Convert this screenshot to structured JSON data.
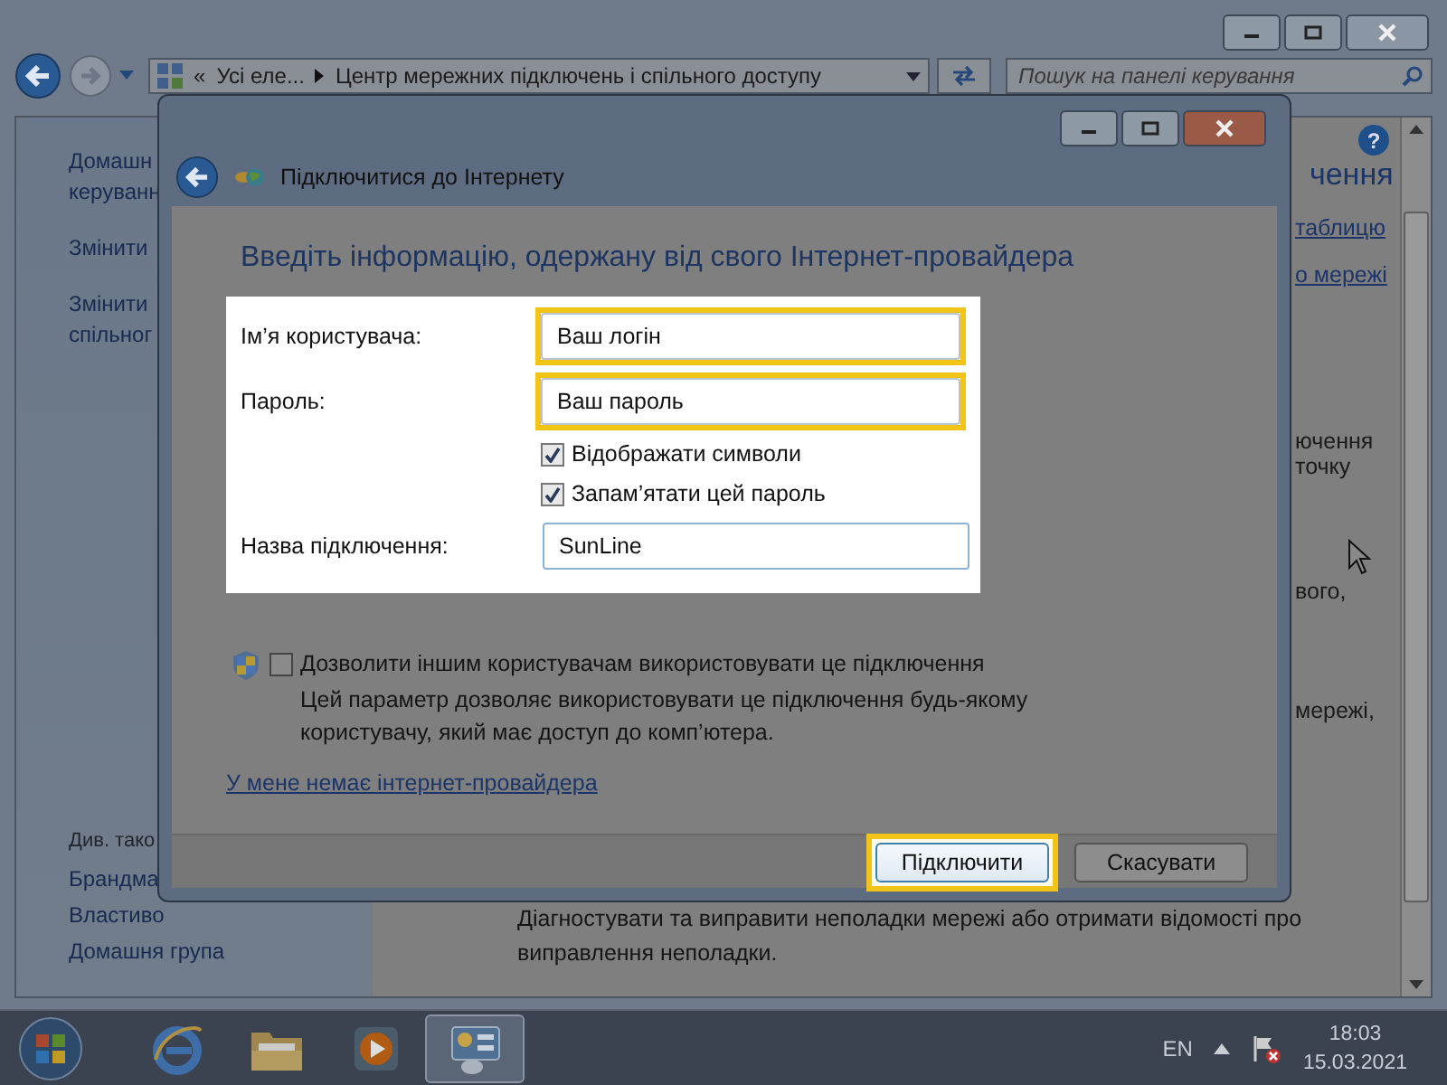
{
  "background_window": {
    "address_bar": {
      "chevron": "«",
      "segments": [
        "Усі еле...",
        "Центр мережних підключень і спільного доступу"
      ]
    },
    "search": {
      "placeholder": "Пошук на панелі керування"
    },
    "help": "?",
    "sidebar": {
      "links": [
        {
          "lines": [
            "Домашн",
            "керуванн"
          ]
        },
        {
          "lines": [
            "Змінити"
          ]
        },
        {
          "lines": [
            "Змінити",
            "спільног"
          ]
        }
      ],
      "see_also_heading": "Див. тако",
      "see_also": [
        "Брандма",
        "Властиво",
        "Домашня група"
      ]
    },
    "fragments": [
      {
        "kind": "heading",
        "text": "чення"
      },
      {
        "kind": "link",
        "text": "таблицю"
      },
      {
        "kind": "link",
        "text": "о мережі"
      },
      {
        "kind": "text",
        "text": "ючення"
      },
      {
        "kind": "text",
        "text": "точку"
      },
      {
        "kind": "text",
        "text": "вого,"
      },
      {
        "kind": "text",
        "text": "мережі,"
      }
    ],
    "footer_text": "Діагностувати та виправити неполадки мережі або отримати відомості про виправлення неполадки."
  },
  "dialog": {
    "title": "Підключитися до Інтернету",
    "heading": "Введіть інформацію, одержану від свого Інтернет-провайдера",
    "form": [
      {
        "kind": "field",
        "label": "Ім’я користувача:",
        "value": "Ваш логін",
        "highlighted": true
      },
      {
        "kind": "field",
        "label": "Пароль:",
        "value": "Ваш пароль",
        "highlighted": true
      },
      {
        "kind": "checkbox",
        "label": "Відображати символи",
        "checked": true
      },
      {
        "kind": "checkbox",
        "label": "Запам’ятати цей пароль",
        "checked": true
      },
      {
        "kind": "field",
        "label": "Назва підключення:",
        "value": "SunLine",
        "highlighted": false
      }
    ],
    "share": {
      "label": "Дозволити іншим користувачам використовувати це підключення",
      "checked": false,
      "description": "Цей параметр дозволяє використовувати це підключення будь-якому користувачу, який має доступ до комп’ютера."
    },
    "link": "У мене немає інтернет-провайдера",
    "buttons": [
      {
        "label": "Підключити",
        "highlighted": true
      },
      {
        "label": "Скасувати",
        "highlighted": false
      }
    ]
  },
  "taskbar": {
    "apps": [
      {
        "kind": "browser",
        "active": false
      },
      {
        "kind": "folder",
        "active": false
      },
      {
        "kind": "media",
        "active": false
      },
      {
        "kind": "control-panel",
        "active": true
      }
    ],
    "language": "EN",
    "time": "18:03",
    "date": "15.03.2021"
  }
}
